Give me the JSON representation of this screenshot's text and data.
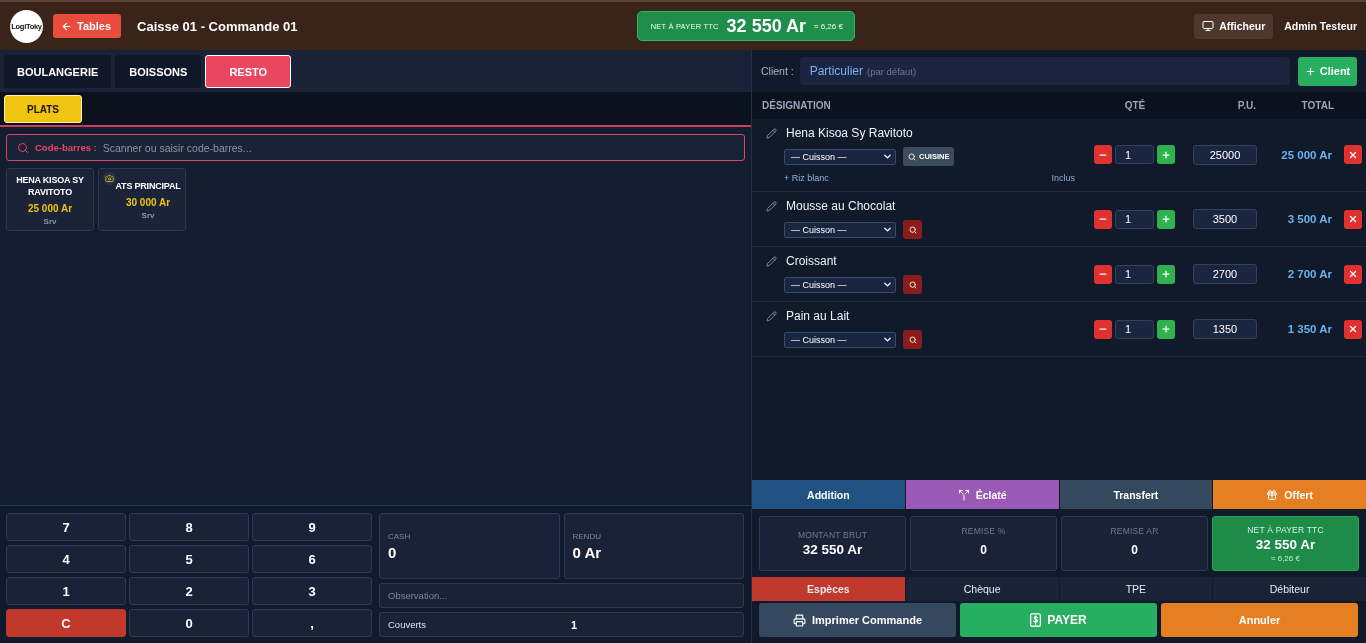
{
  "header": {
    "logo": "LogiToky",
    "back_button": "Tables",
    "title": "Caisse 01 - Commande 01",
    "total": {
      "label": "NET À PAYER TTC",
      "amount": "32 550 Ar",
      "converted": "≈ 6,26 €"
    },
    "display_button": "Afficheur",
    "user": "Admin Testeur"
  },
  "categories": [
    {
      "label": "BOULANGERIE",
      "selected": false
    },
    {
      "label": "BOISSONS",
      "selected": false
    },
    {
      "label": "RESTO",
      "selected": true
    }
  ],
  "subcategories": [
    {
      "label": "PLATS",
      "selected": true
    }
  ],
  "barcode": {
    "label": "Code-barres :",
    "placeholder": "Scanner ou saisir code-barres..."
  },
  "products": [
    {
      "name": "HENA KISOA SY RAVITOTO",
      "price": "25 000 Ar",
      "unit": "Srv",
      "photo_icon": false
    },
    {
      "name": "ATS PRINCIPAL",
      "price": "30 000 Ar",
      "unit": "Srv",
      "photo_icon": true
    }
  ],
  "keypad": [
    {
      "label": "7",
      "kind": "digit"
    },
    {
      "label": "8",
      "kind": "digit"
    },
    {
      "label": "9",
      "kind": "digit"
    },
    {
      "label": "4",
      "kind": "digit"
    },
    {
      "label": "5",
      "kind": "digit"
    },
    {
      "label": "6",
      "kind": "digit"
    },
    {
      "label": "1",
      "kind": "digit"
    },
    {
      "label": "2",
      "kind": "digit"
    },
    {
      "label": "3",
      "kind": "digit"
    },
    {
      "label": "C",
      "kind": "clear"
    },
    {
      "label": "0",
      "kind": "digit"
    },
    {
      "label": ",",
      "kind": "digit"
    }
  ],
  "cash": {
    "label": "CASH",
    "value": "0"
  },
  "change": {
    "label": "RENDU",
    "value": "0 Ar"
  },
  "observation": {
    "placeholder": "Observation..."
  },
  "covers": {
    "label": "Couverts",
    "value": "1"
  },
  "client": {
    "label": "Client :",
    "name": "Particulier",
    "note": "(par défaut)",
    "add_button": "Client"
  },
  "order": {
    "columns": [
      "DÉSIGNATION",
      "QTÉ",
      "P.U.",
      "TOTAL"
    ],
    "lines": [
      {
        "name": "Hena Kisoa Sy Ravitoto",
        "cooking": "— Cuisson —",
        "kitchen": {
          "selected": true,
          "label": "CUISINE"
        },
        "extras": [
          {
            "name": "+ Riz blanc",
            "price": "Inclus"
          }
        ],
        "qty": "1",
        "unit_price": "25000",
        "total": "25 000 Ar"
      },
      {
        "name": "Mousse au Chocolat",
        "cooking": "— Cuisson —",
        "kitchen": {
          "selected": false
        },
        "qty": "1",
        "unit_price": "3500",
        "total": "3 500 Ar"
      },
      {
        "name": "Croissant",
        "cooking": "— Cuisson —",
        "kitchen": {
          "selected": false
        },
        "qty": "1",
        "unit_price": "2700",
        "total": "2 700 Ar"
      },
      {
        "name": "Pain au Lait",
        "cooking": "— Cuisson —",
        "kitchen": {
          "selected": false
        },
        "qty": "1",
        "unit_price": "1350",
        "total": "1 350 Ar"
      }
    ]
  },
  "actions": [
    {
      "label": "Addition",
      "kind": "addition"
    },
    {
      "label": "Éclaté",
      "kind": "split"
    },
    {
      "label": "Transfert",
      "kind": "transfer"
    },
    {
      "label": "Offert",
      "kind": "gift"
    }
  ],
  "summary": [
    {
      "label": "MONTANT BRUT",
      "value": "32 550 Ar",
      "kind": "amount"
    },
    {
      "label": "REMISE %",
      "value": "0",
      "kind": "discount"
    },
    {
      "label": "REMISE AR",
      "value": "0",
      "kind": "discount"
    },
    {
      "label": "NET À PAYER TTC",
      "value": "32 550 Ar",
      "converted": "≈ 6,26 €",
      "kind": "net"
    }
  ],
  "payment_methods": [
    {
      "label": "Espèces",
      "selected": true
    },
    {
      "label": "Chèque",
      "selected": false
    },
    {
      "label": "TPE",
      "selected": false
    },
    {
      "label": "Débiteur",
      "selected": false
    }
  ],
  "footer_buttons": [
    {
      "label": "Imprimer Commande",
      "kind": "print"
    },
    {
      "label": "PAYER",
      "kind": "pay"
    },
    {
      "label": "Annuler",
      "kind": "cancel"
    }
  ]
}
